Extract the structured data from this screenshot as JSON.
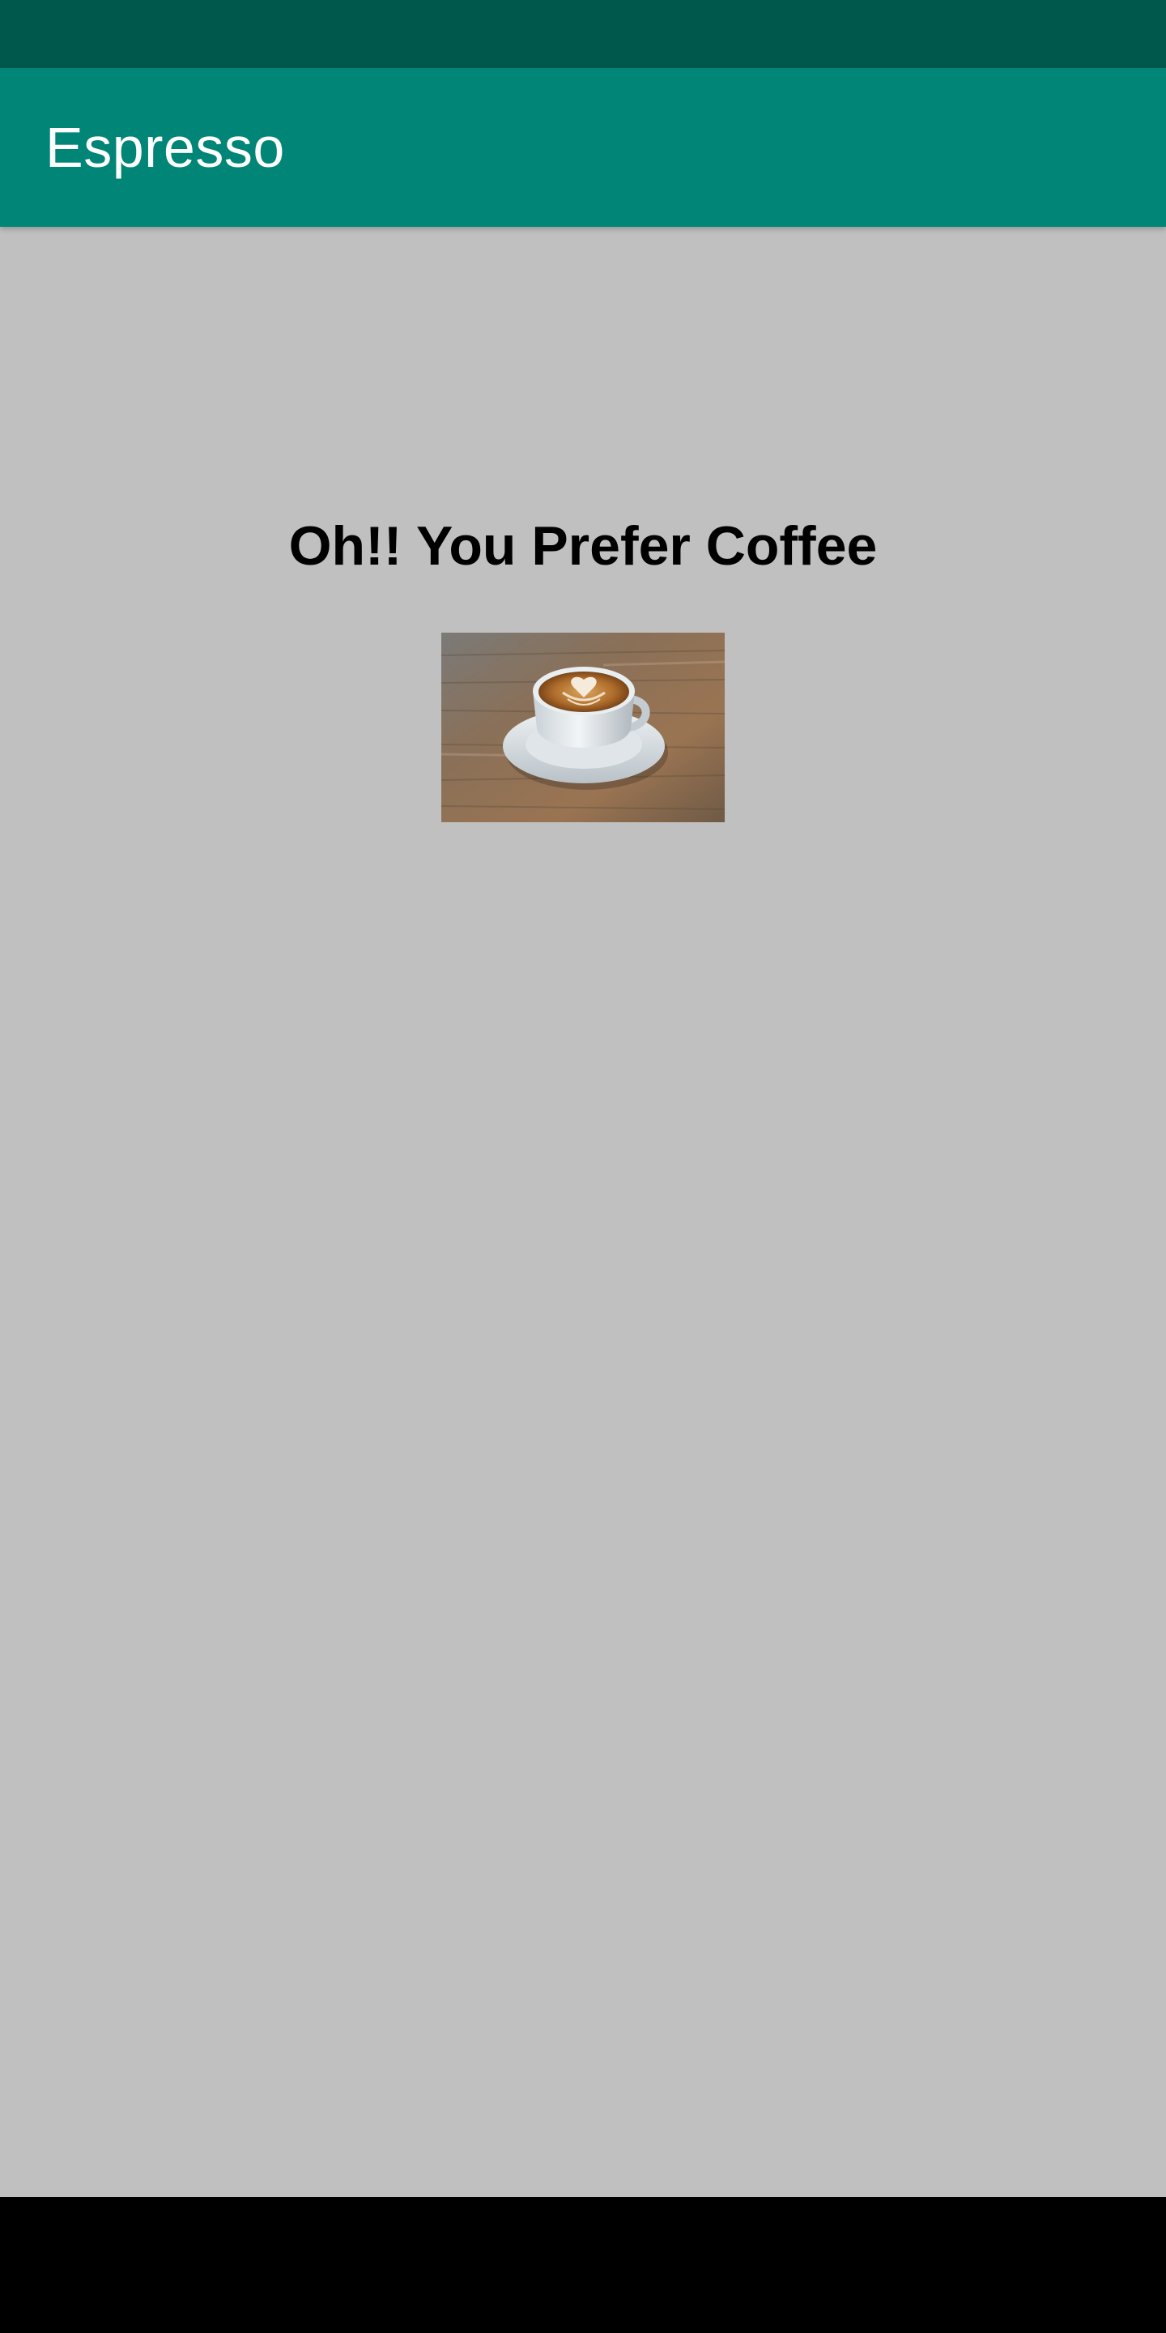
{
  "app_bar": {
    "title": "Espresso"
  },
  "main": {
    "headline": "Oh!! You Prefer Coffee",
    "image": {
      "subject": "latte-cup-on-saucer"
    }
  },
  "colors": {
    "status_bar": "#00574b",
    "app_bar": "#008577",
    "background": "#c0c0c0",
    "nav_bar": "#000000"
  }
}
